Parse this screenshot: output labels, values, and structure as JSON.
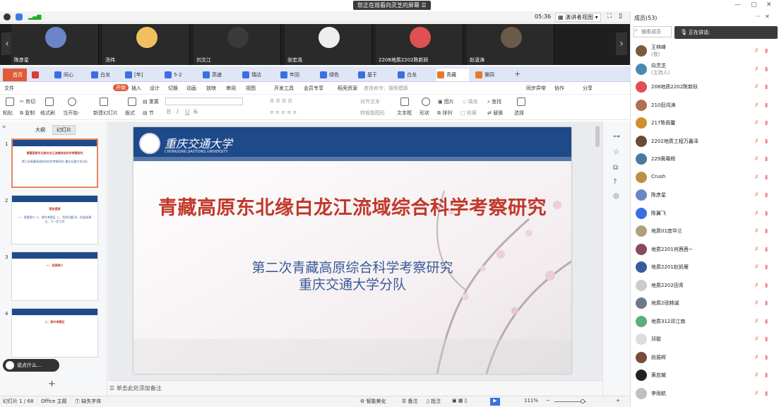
{
  "window": {
    "share_banner": "您正在观看向灵芝的屏幕",
    "minimize": "—",
    "restore": "▢",
    "close": "✕"
  },
  "meeting": {
    "time": "05:36",
    "view_mode": "演讲者视图",
    "members_title": "成员(53)",
    "search_placeholder": "搜索成员",
    "speaking": "正在讲话:",
    "more": "···",
    "close": "✕"
  },
  "video_tiles": [
    {
      "name": "陈彦星",
      "color": "#6a86c8"
    },
    {
      "name": "汤伟",
      "color": "#f0c060"
    },
    {
      "name": "刘文江",
      "color": "#3a3a3a"
    },
    {
      "name": "张宏浩",
      "color": "#eeeeee"
    },
    {
      "name": "2208地质2202陈新跃",
      "color": "#e05050"
    },
    {
      "name": "赵凌涛",
      "color": "#6a5a4a"
    }
  ],
  "tabs": [
    {
      "label": "首页",
      "color": "#e05b3a"
    },
    {
      "label": "",
      "color": "#e03a3a"
    },
    {
      "label": "同心",
      "color": "#3a6fe0"
    },
    {
      "label": "白龙",
      "color": "#3a6fe0"
    },
    {
      "label": "[年]",
      "color": "#3a6fe0"
    },
    {
      "label": "5-2",
      "color": "#3a6fe0"
    },
    {
      "label": "高速",
      "color": "#3a6fe0"
    },
    {
      "label": "瑞达",
      "color": "#3a6fe0"
    },
    {
      "label": "年回",
      "color": "#3a6fe0"
    },
    {
      "label": "绿色",
      "color": "#3a6fe0"
    },
    {
      "label": "基于",
      "color": "#3a6fe0"
    },
    {
      "label": "白龙",
      "color": "#3a6fe0"
    },
    {
      "label": "青藏",
      "color": "#e57b2a"
    },
    {
      "label": "第四",
      "color": "#e57b2a"
    }
  ],
  "menu": [
    "文件",
    "开始",
    "插入",
    "设计",
    "切换",
    "动画",
    "放映",
    "审阅",
    "视图",
    "开发工具",
    "会员专享",
    "稻壳资源"
  ],
  "menu_search": "查找命令、搜索模板",
  "menu_right": [
    "同步异常",
    "协作",
    "分享"
  ],
  "ribbon": {
    "paste": "粘贴",
    "cut": "剪切",
    "copy": "复制",
    "format_painter": "格式刷",
    "start_from_current": "当开始-",
    "new_slide": "新建幻灯片",
    "layout": "版式",
    "section": "节",
    "reset": "重置",
    "bold": "B",
    "italic": "I",
    "underline": "U",
    "strike": "S",
    "textbox": "文本框",
    "shape": "形状",
    "arrange": "排列",
    "outline": "轮廓",
    "find": "查找",
    "replace": "替换",
    "select": "选择",
    "picture": "图片",
    "fill": "填充",
    "smart_art": "转智能图形",
    "text_align": "对齐文本"
  },
  "panel": {
    "outline": "大纲",
    "slides": "幻灯片",
    "collapse": "«"
  },
  "thumbs": [
    {
      "num": "1",
      "title": "青藏高原东北缘白龙江流域综合科学考察研究",
      "sub": "第二次青藏高原综合科学考察研究 重庆交通大学分队"
    },
    {
      "num": "2",
      "title": "报告提纲",
      "sub": "一、背景简介 二、野外考察区 三、科学问题 四、阶段成果 五、下一步工作"
    },
    {
      "num": "3",
      "title": "一、背景简介",
      "sub": ""
    },
    {
      "num": "4",
      "title": "二、野外考察区",
      "sub": ""
    }
  ],
  "slide": {
    "logo_cn": "重庆交通大学",
    "logo_en": "CHONGQING JIAOTONG UNIVERSITY",
    "title": "青藏高原东北缘白龙江流域综合科学考察研究",
    "subtitle1": "第二次青藏高原综合科学考察研究",
    "subtitle2": "重庆交通大学分队"
  },
  "notes_hint": "单击此处添加备注",
  "chat_hint": "说点什么…",
  "status": {
    "slide_info": "幻灯片 1 / 68",
    "theme": "Office 主题",
    "font_missing": "缺失字体",
    "smart": "智能美化",
    "notes": "备注",
    "comments": "批注",
    "zoom": "111%",
    "minus": "−",
    "plus": "+"
  },
  "members": [
    {
      "name": "王林峰",
      "role": "(我)",
      "color": "#7a5a3a"
    },
    {
      "name": "向灵芝",
      "role": "(主持人)",
      "color": "#4a8ab0"
    },
    {
      "name": "208地质2202陈新跃",
      "role": "",
      "color": "#e05050"
    },
    {
      "name": "210田鸿涛",
      "role": "",
      "color": "#b07050"
    },
    {
      "name": "217陈雨馨",
      "role": "",
      "color": "#d09030"
    },
    {
      "name": "2202地质工程万鑫泽",
      "role": "",
      "color": "#6a4a3a"
    },
    {
      "name": "229黄骞辉",
      "role": "",
      "color": "#4a7aa0"
    },
    {
      "name": "Crush",
      "role": "",
      "color": "#c09040"
    },
    {
      "name": "陈彦星",
      "role": "",
      "color": "#6a86c8"
    },
    {
      "name": "陈翼飞",
      "role": "",
      "color": "#3a6fe0"
    },
    {
      "name": "地质01庞华兰",
      "role": "",
      "color": "#b0a080"
    },
    {
      "name": "地质2201何茜茜~",
      "role": "",
      "color": "#8a4a5a"
    },
    {
      "name": "地质2201赵凯雁",
      "role": "",
      "color": "#3a5a9a"
    },
    {
      "name": "地质2202田青",
      "role": "",
      "color": "#cccccc"
    },
    {
      "name": "地质2班韩诚",
      "role": "",
      "color": "#6a7a8a"
    },
    {
      "name": "地质312邓江南",
      "role": "",
      "color": "#5ab07a"
    },
    {
      "name": "邓聪",
      "role": "",
      "color": "#dddddd"
    },
    {
      "name": "段振辉",
      "role": "",
      "color": "#7a4a3a"
    },
    {
      "name": "黄启耀",
      "role": "",
      "color": "#222222"
    },
    {
      "name": "李雨航",
      "role": "",
      "color": "#c0c0c0"
    }
  ]
}
